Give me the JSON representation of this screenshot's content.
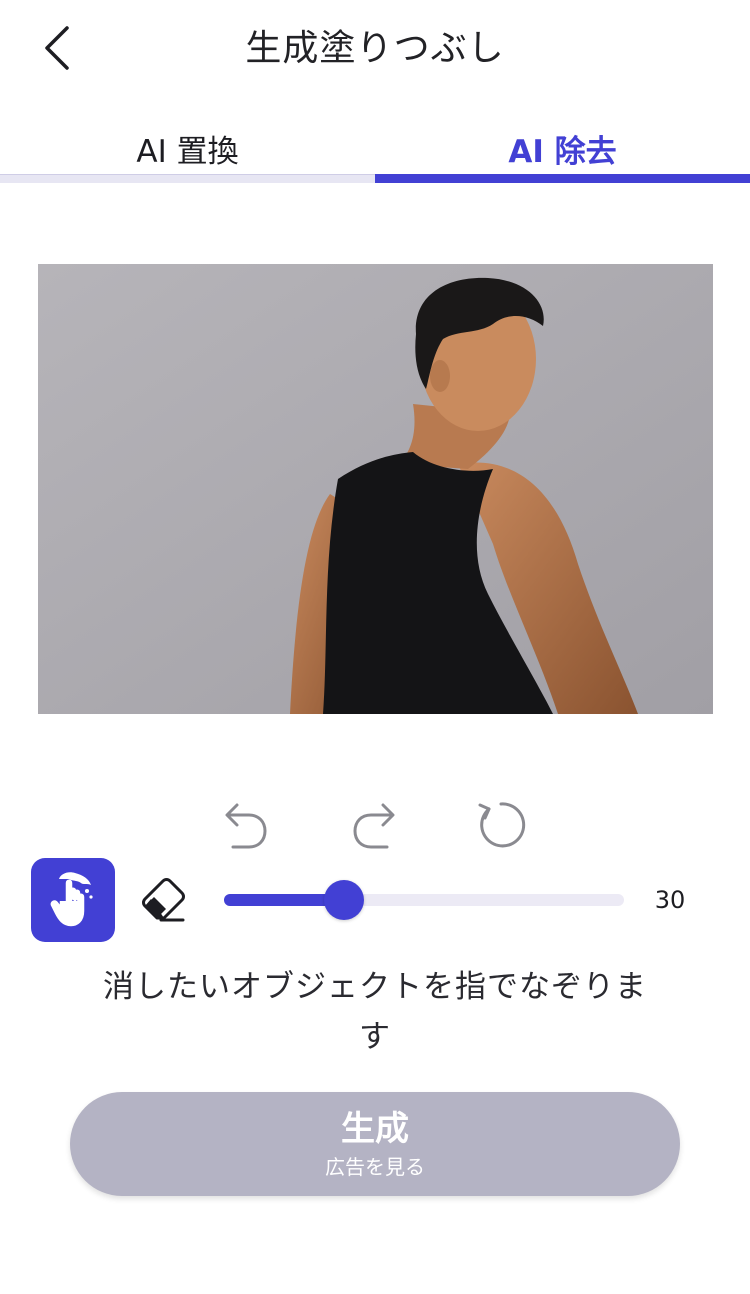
{
  "header": {
    "title": "生成塗りつぶし",
    "back_icon": "chevron-left-icon"
  },
  "tabs": [
    {
      "label": "AI 置換",
      "active": false
    },
    {
      "label": "AI 除去",
      "active": true
    }
  ],
  "colors": {
    "accent": "#4240d4",
    "button_disabled": "#b4b3c4",
    "background": "#ffffff"
  },
  "canvas": {
    "icons": [
      "undo-icon",
      "redo-icon",
      "reset-icon"
    ]
  },
  "tools": {
    "brush_icon": "hand-brush-icon",
    "eraser_icon": "eraser-icon",
    "brush_size": {
      "min": 0,
      "max": 100,
      "value": 30,
      "label": "30"
    }
  },
  "hint": "消したいオブジェクトを指でなぞります",
  "generate": {
    "label": "生成",
    "sublabel": "広告を見る"
  }
}
